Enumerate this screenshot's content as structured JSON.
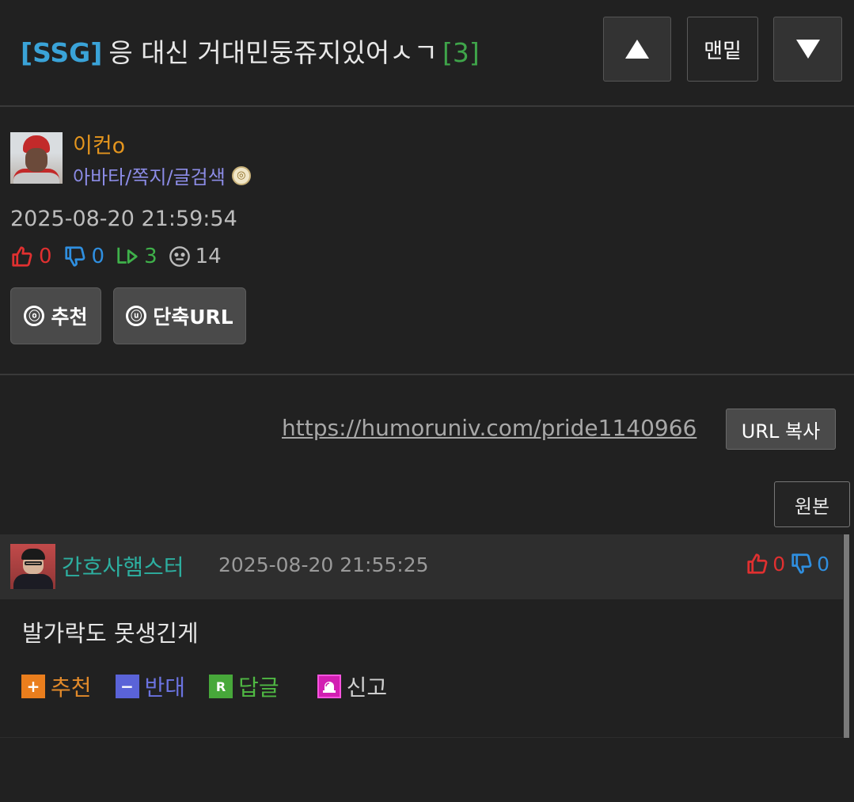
{
  "header": {
    "tag": "[SSG]",
    "title": "응 대신 거대민둥쥬지있어ㅅㄱ",
    "comment_count": "[3]",
    "up_icon": "triangle-up-icon",
    "bottom_label": "맨밑",
    "down_icon": "triangle-down-icon"
  },
  "author": {
    "name": "이컨o",
    "links": "아바타/쪽지/글검색",
    "badge_icon": "medal-badge-icon",
    "date": "2025-08-20 21:59:54"
  },
  "stats": {
    "likes": "0",
    "dislikes": "0",
    "replies": "3",
    "views": "14"
  },
  "actions": {
    "recommend_icon": "ⓞ",
    "recommend_label": "추천",
    "shorturl_icon": "ⓤ",
    "shorturl_label": "단축URL"
  },
  "url": {
    "link": "https://humoruniv.com/pride1140966",
    "copy_label": "URL 복사",
    "original_label": "원본"
  },
  "comment": {
    "author": "간호사햄스터",
    "date": "2025-08-20 21:55:25",
    "likes": "0",
    "dislikes": "0",
    "body": "발가락도 못생긴게",
    "recommend_label": "추천",
    "oppose_label": "반대",
    "reply_label": "답글",
    "report_label": "신고"
  },
  "colors": {
    "background": "#212121",
    "tag_blue": "#3aa3d8",
    "count_green": "#3fa54a",
    "author_orange": "#e4951e",
    "link_purple": "#8c8ce6",
    "commenter_teal": "#2dafa0"
  }
}
